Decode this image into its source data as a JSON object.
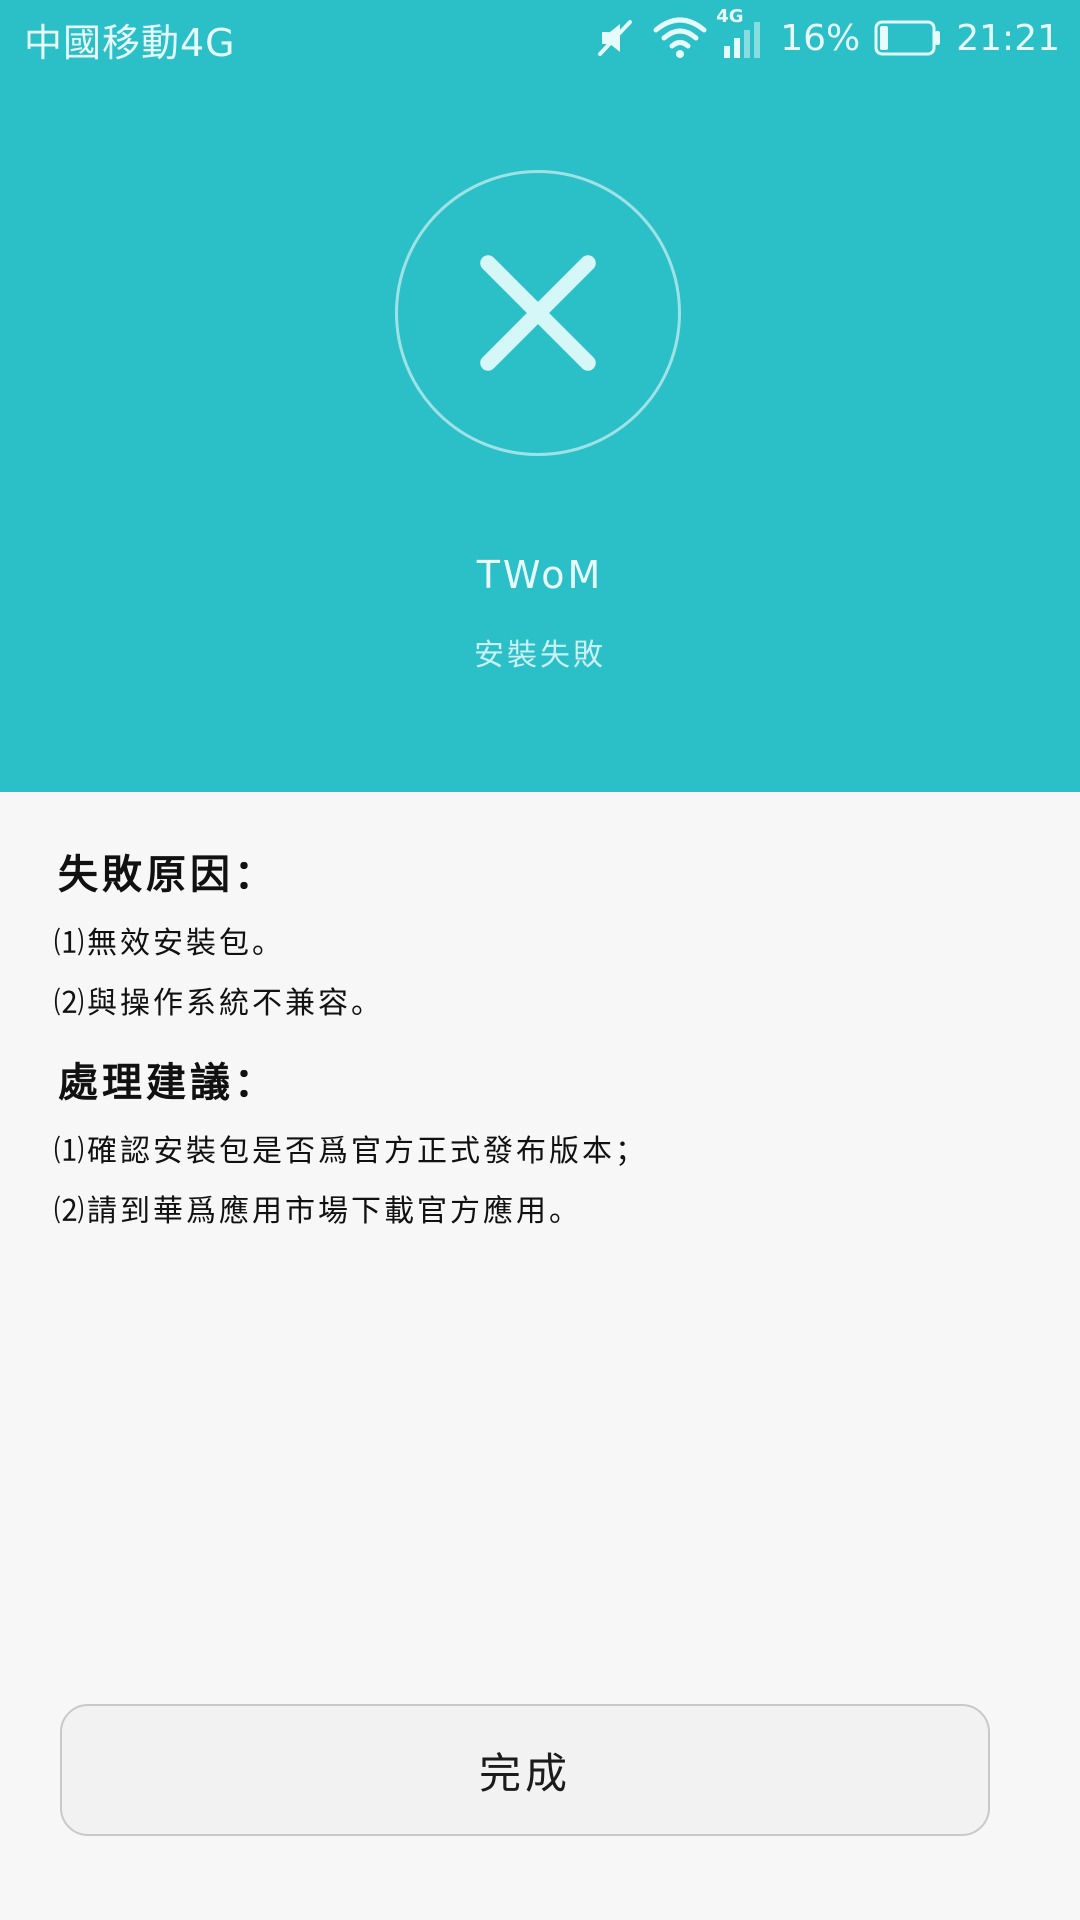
{
  "status_bar": {
    "carrier": "中國移動4G",
    "network_badge": "4G",
    "battery_percent": "16%",
    "battery_level": 0.16,
    "time": "21:21",
    "icons": [
      "mute-icon",
      "wifi-icon",
      "signal-icon",
      "battery-icon"
    ]
  },
  "install_result": {
    "app_name": "TWoM",
    "status": "安裝失敗",
    "result_icon": "close-icon"
  },
  "failure_reasons": {
    "title": "失敗原因：",
    "items": [
      "⑴無效安裝包。",
      "⑵與操作系統不兼容。"
    ]
  },
  "suggestions": {
    "title": "處理建議：",
    "items": [
      "⑴確認安裝包是否爲官方正式發布版本；",
      "⑵請到華爲應用市場下載官方應用。"
    ]
  },
  "actions": {
    "done_label": "完成"
  },
  "colors": {
    "header_bg": "#2bbfc7",
    "page_bg": "#f7f7f7",
    "text": "#111111"
  }
}
